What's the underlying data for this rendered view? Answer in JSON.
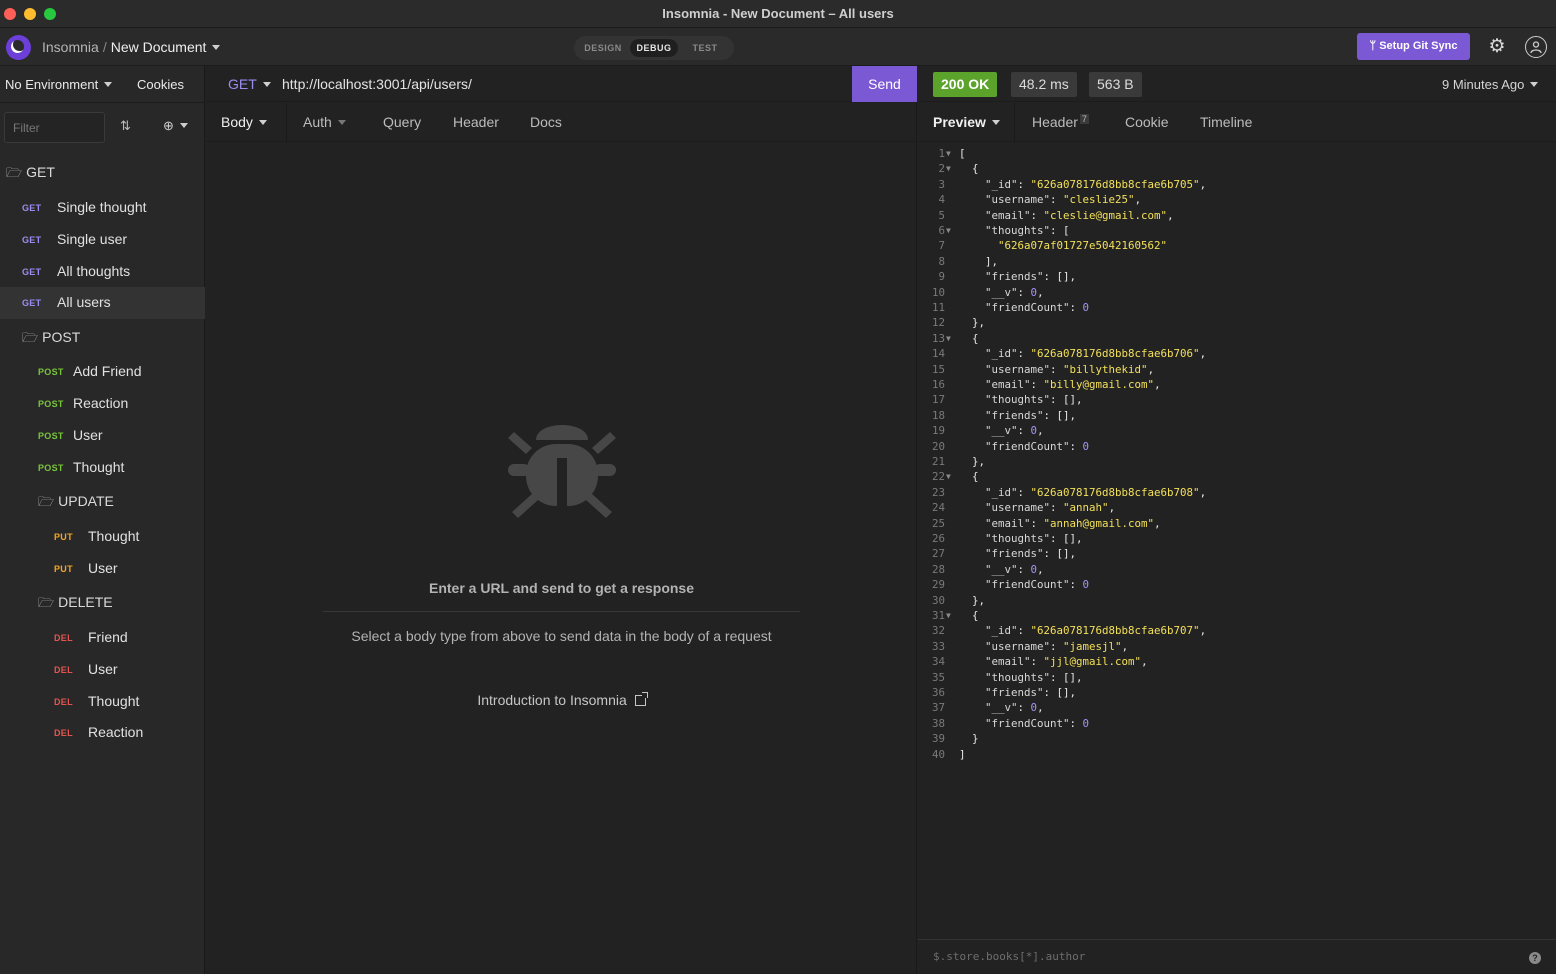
{
  "window": {
    "title": "Insomnia - New Document – All users"
  },
  "header": {
    "app_name": "Insomnia",
    "separator": "/",
    "document": "New Document",
    "modes": [
      "DESIGN",
      "DEBUG",
      "TEST"
    ],
    "active_mode": "DEBUG",
    "git_sync_label": "ᛘ Setup Git Sync"
  },
  "sidebar": {
    "environment": "No Environment",
    "cookies": "Cookies",
    "filter_placeholder": "Filter",
    "folders": {
      "get": "GET",
      "post": "POST",
      "update": "UPDATE",
      "delete": "DELETE"
    },
    "requests": [
      {
        "method": "GET",
        "name": "Single thought"
      },
      {
        "method": "GET",
        "name": "Single user"
      },
      {
        "method": "GET",
        "name": "All thoughts"
      },
      {
        "method": "GET",
        "name": "All users"
      },
      {
        "method": "POST",
        "name": "Add Friend"
      },
      {
        "method": "POST",
        "name": "Reaction"
      },
      {
        "method": "POST",
        "name": "User"
      },
      {
        "method": "POST",
        "name": "Thought"
      },
      {
        "method": "PUT",
        "name": "Thought"
      },
      {
        "method": "PUT",
        "name": "User"
      },
      {
        "method": "DEL",
        "name": "Friend"
      },
      {
        "method": "DEL",
        "name": "User"
      },
      {
        "method": "DEL",
        "name": "Thought"
      },
      {
        "method": "DEL",
        "name": "Reaction"
      }
    ]
  },
  "request": {
    "method": "GET",
    "url": "http://localhost:3001/api/users/",
    "send_label": "Send",
    "tabs": [
      "Body",
      "Auth",
      "Query",
      "Header",
      "Docs"
    ],
    "empty_title": "Enter a URL and send to get a response",
    "empty_subtitle": "Select a body type from above to send data in the body of a request",
    "intro_link": "Introduction to Insomnia"
  },
  "response": {
    "status": "200 OK",
    "time": "48.2 ms",
    "size": "563 B",
    "ago": "9 Minutes Ago",
    "tabs": [
      "Preview",
      "Header",
      "Cookie",
      "Timeline"
    ],
    "header_count": "7",
    "filter_placeholder": "$.store.books[*].author",
    "help": "?",
    "lines": [
      "[",
      "  {",
      "    \"_id\": \"626a078176d8bb8cfae6b705\",",
      "    \"username\": \"cleslie25\",",
      "    \"email\": \"cleslie@gmail.com\",",
      "    \"thoughts\": [",
      "      \"626a07af01727e5042160562\"",
      "    ],",
      "    \"friends\": [],",
      "    \"__v\": 0,",
      "    \"friendCount\": 0",
      "  },",
      "  {",
      "    \"_id\": \"626a078176d8bb8cfae6b706\",",
      "    \"username\": \"billythekid\",",
      "    \"email\": \"billy@gmail.com\",",
      "    \"thoughts\": [],",
      "    \"friends\": [],",
      "    \"__v\": 0,",
      "    \"friendCount\": 0",
      "  },",
      "  {",
      "    \"_id\": \"626a078176d8bb8cfae6b708\",",
      "    \"username\": \"annah\",",
      "    \"email\": \"annah@gmail.com\",",
      "    \"thoughts\": [],",
      "    \"friends\": [],",
      "    \"__v\": 0,",
      "    \"friendCount\": 0",
      "  },",
      "  {",
      "    \"_id\": \"626a078176d8bb8cfae6b707\",",
      "    \"username\": \"jamesjl\",",
      "    \"email\": \"jjl@gmail.com\",",
      "    \"thoughts\": [],",
      "    \"friends\": [],",
      "    \"__v\": 0,",
      "    \"friendCount\": 0",
      "  }",
      "]"
    ],
    "foldable_lines": [
      1,
      2,
      6,
      13,
      22,
      31
    ]
  },
  "colors": {
    "accent": "#7b58d4",
    "status_ok": "#5ba32b",
    "get": "#9a8df0",
    "post": "#79c63a",
    "put": "#f5a623",
    "delete": "#e4544f"
  }
}
